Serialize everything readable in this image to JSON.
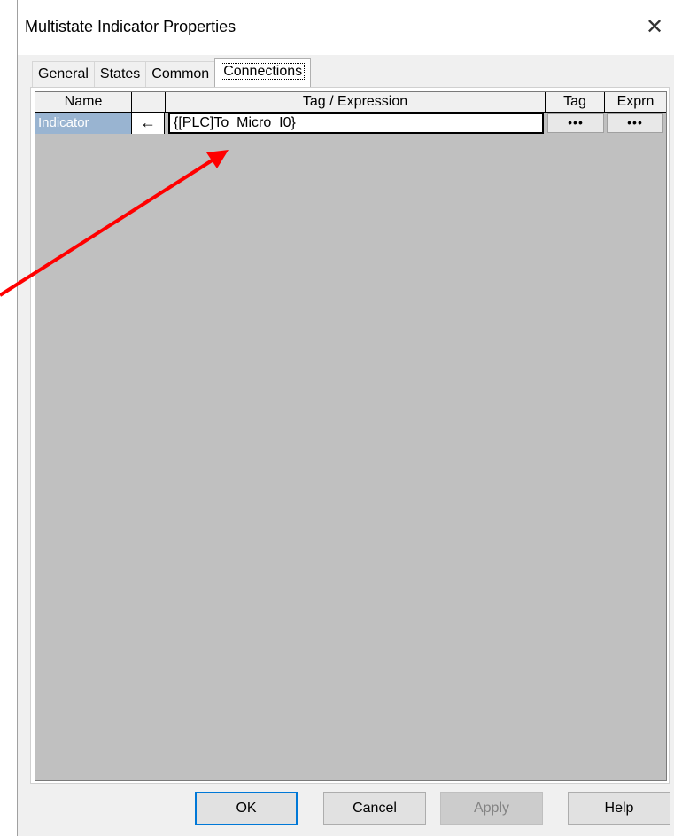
{
  "window": {
    "title": "Multistate Indicator Properties",
    "close_glyph": "✕"
  },
  "tabs": [
    {
      "label": "General",
      "active": false
    },
    {
      "label": "States",
      "active": false
    },
    {
      "label": "Common",
      "active": false
    },
    {
      "label": "Connections",
      "active": true
    }
  ],
  "grid": {
    "headers": {
      "name": "Name",
      "arrow": "",
      "expression": "Tag / Expression",
      "tag": "Tag",
      "exprn": "Exprn"
    },
    "rows": [
      {
        "name": "Indicator",
        "direction_glyph": "←",
        "expression": "{[PLC]To_Micro_I0}",
        "tag_button": "•••",
        "exprn_button": "•••"
      }
    ]
  },
  "buttons": {
    "ok": "OK",
    "cancel": "Cancel",
    "apply": "Apply",
    "help": "Help"
  },
  "colors": {
    "selection": "#99b4d1",
    "grid_background": "#c0c0c0",
    "annotation_arrow": "#ff0000",
    "default_button_border": "#0078d7"
  }
}
